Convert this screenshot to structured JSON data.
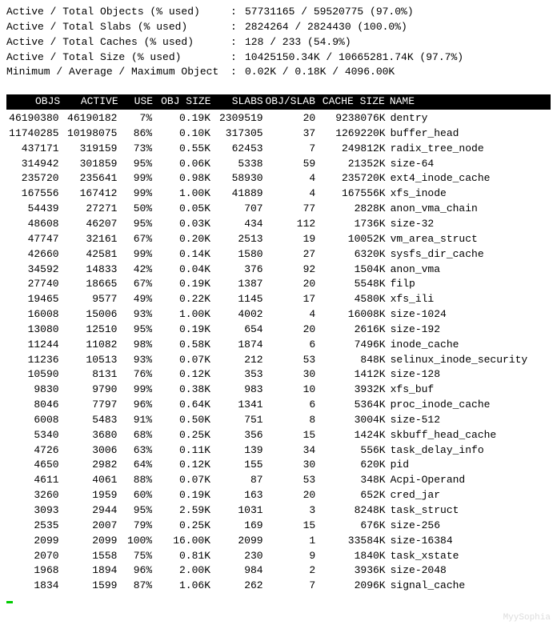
{
  "summary": [
    {
      "label": "Active / Total Objects (% used)",
      "value": "57731165 / 59520775 (97.0%)"
    },
    {
      "label": "Active / Total Slabs (% used)",
      "value": "2824264 / 2824430 (100.0%)"
    },
    {
      "label": "Active / Total Caches (% used)",
      "value": "128 / 233 (54.9%)"
    },
    {
      "label": "Active / Total Size (% used)",
      "value": "10425150.34K / 10665281.74K (97.7%)"
    },
    {
      "label": "Minimum / Average / Maximum Object",
      "value": "0.02K / 0.18K / 4096.00K"
    }
  ],
  "columns": {
    "objs": "OBJS",
    "active": "ACTIVE",
    "use": "USE",
    "objsize": "OBJ SIZE",
    "slabs": "SLABS",
    "objslab": "OBJ/SLAB",
    "cachesize": "CACHE SIZE",
    "name": "NAME"
  },
  "chart_data": {
    "type": "table",
    "title": "slabtop",
    "columns": [
      "OBJS",
      "ACTIVE",
      "USE",
      "OBJ SIZE",
      "SLABS",
      "OBJ/SLAB",
      "CACHE SIZE",
      "NAME"
    ],
    "rows": [
      [
        "46190380",
        "46190182",
        "7%",
        "0.19K",
        "2309519",
        "20",
        "9238076K",
        "dentry"
      ],
      [
        "11740285",
        "10198075",
        "86%",
        "0.10K",
        "317305",
        "37",
        "1269220K",
        "buffer_head"
      ],
      [
        "437171",
        "319159",
        "73%",
        "0.55K",
        "62453",
        "7",
        "249812K",
        "radix_tree_node"
      ],
      [
        "314942",
        "301859",
        "95%",
        "0.06K",
        "5338",
        "59",
        "21352K",
        "size-64"
      ],
      [
        "235720",
        "235641",
        "99%",
        "0.98K",
        "58930",
        "4",
        "235720K",
        "ext4_inode_cache"
      ],
      [
        "167556",
        "167412",
        "99%",
        "1.00K",
        "41889",
        "4",
        "167556K",
        "xfs_inode"
      ],
      [
        "54439",
        "27271",
        "50%",
        "0.05K",
        "707",
        "77",
        "2828K",
        "anon_vma_chain"
      ],
      [
        "48608",
        "46207",
        "95%",
        "0.03K",
        "434",
        "112",
        "1736K",
        "size-32"
      ],
      [
        "47747",
        "32161",
        "67%",
        "0.20K",
        "2513",
        "19",
        "10052K",
        "vm_area_struct"
      ],
      [
        "42660",
        "42581",
        "99%",
        "0.14K",
        "1580",
        "27",
        "6320K",
        "sysfs_dir_cache"
      ],
      [
        "34592",
        "14833",
        "42%",
        "0.04K",
        "376",
        "92",
        "1504K",
        "anon_vma"
      ],
      [
        "27740",
        "18665",
        "67%",
        "0.19K",
        "1387",
        "20",
        "5548K",
        "filp"
      ],
      [
        "19465",
        "9577",
        "49%",
        "0.22K",
        "1145",
        "17",
        "4580K",
        "xfs_ili"
      ],
      [
        "16008",
        "15006",
        "93%",
        "1.00K",
        "4002",
        "4",
        "16008K",
        "size-1024"
      ],
      [
        "13080",
        "12510",
        "95%",
        "0.19K",
        "654",
        "20",
        "2616K",
        "size-192"
      ],
      [
        "11244",
        "11082",
        "98%",
        "0.58K",
        "1874",
        "6",
        "7496K",
        "inode_cache"
      ],
      [
        "11236",
        "10513",
        "93%",
        "0.07K",
        "212",
        "53",
        "848K",
        "selinux_inode_security"
      ],
      [
        "10590",
        "8131",
        "76%",
        "0.12K",
        "353",
        "30",
        "1412K",
        "size-128"
      ],
      [
        "9830",
        "9790",
        "99%",
        "0.38K",
        "983",
        "10",
        "3932K",
        "xfs_buf"
      ],
      [
        "8046",
        "7797",
        "96%",
        "0.64K",
        "1341",
        "6",
        "5364K",
        "proc_inode_cache"
      ],
      [
        "6008",
        "5483",
        "91%",
        "0.50K",
        "751",
        "8",
        "3004K",
        "size-512"
      ],
      [
        "5340",
        "3680",
        "68%",
        "0.25K",
        "356",
        "15",
        "1424K",
        "skbuff_head_cache"
      ],
      [
        "4726",
        "3006",
        "63%",
        "0.11K",
        "139",
        "34",
        "556K",
        "task_delay_info"
      ],
      [
        "4650",
        "2982",
        "64%",
        "0.12K",
        "155",
        "30",
        "620K",
        "pid"
      ],
      [
        "4611",
        "4061",
        "88%",
        "0.07K",
        "87",
        "53",
        "348K",
        "Acpi-Operand"
      ],
      [
        "3260",
        "1959",
        "60%",
        "0.19K",
        "163",
        "20",
        "652K",
        "cred_jar"
      ],
      [
        "3093",
        "2944",
        "95%",
        "2.59K",
        "1031",
        "3",
        "8248K",
        "task_struct"
      ],
      [
        "2535",
        "2007",
        "79%",
        "0.25K",
        "169",
        "15",
        "676K",
        "size-256"
      ],
      [
        "2099",
        "2099",
        "100%",
        "16.00K",
        "2099",
        "1",
        "33584K",
        "size-16384"
      ],
      [
        "2070",
        "1558",
        "75%",
        "0.81K",
        "230",
        "9",
        "1840K",
        "task_xstate"
      ],
      [
        "1968",
        "1894",
        "96%",
        "2.00K",
        "984",
        "2",
        "3936K",
        "size-2048"
      ],
      [
        "1834",
        "1599",
        "87%",
        "1.06K",
        "262",
        "7",
        "2096K",
        "signal_cache"
      ]
    ]
  },
  "watermark": "MyySophia"
}
